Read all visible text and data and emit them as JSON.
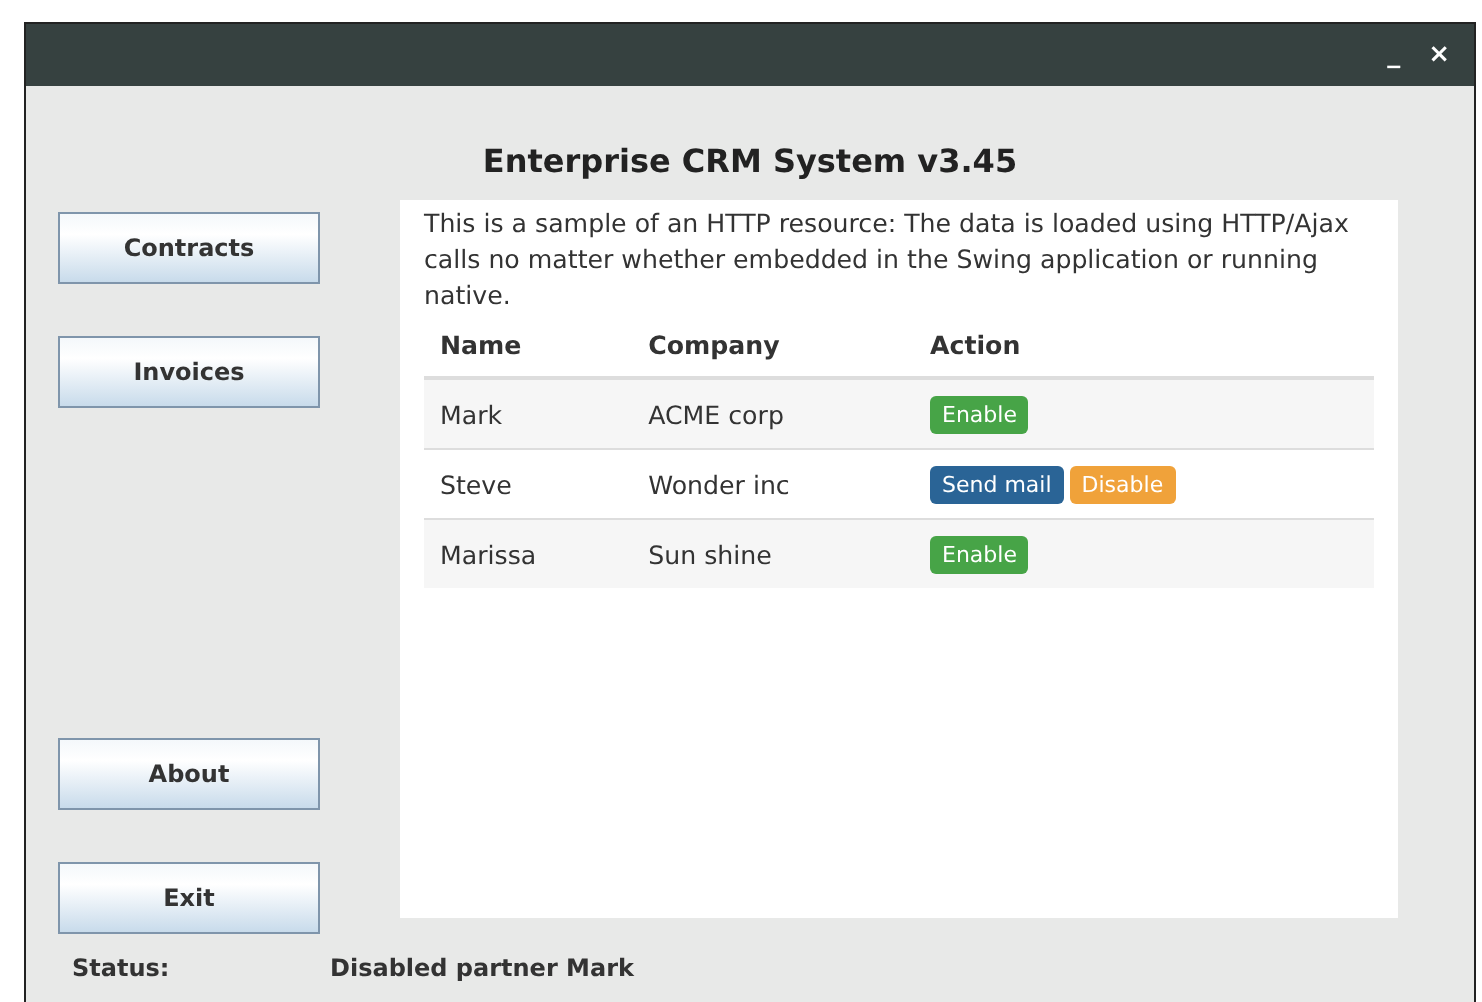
{
  "window": {
    "controls": [
      "_",
      "×"
    ]
  },
  "title": "Enterprise CRM System v3.45",
  "nav_top": [
    "Contracts",
    "Invoices"
  ],
  "nav_bottom": [
    "About",
    "Exit"
  ],
  "description": "This is a sample of an HTTP resource: The data is loaded using HTTP/Ajax calls no matter whether embedded in the Swing application or running native.",
  "table": {
    "columns": [
      "Name",
      "Company",
      "Action"
    ],
    "rows": [
      {
        "name": "Mark",
        "company": "ACME corp",
        "actions": [
          {
            "kind": "enable",
            "label": "Enable"
          }
        ]
      },
      {
        "name": "Steve",
        "company": "Wonder inc",
        "actions": [
          {
            "kind": "mail",
            "label": "Send mail"
          },
          {
            "kind": "disable",
            "label": "Disable"
          }
        ]
      },
      {
        "name": "Marissa",
        "company": "Sun shine",
        "actions": [
          {
            "kind": "enable",
            "label": "Enable"
          }
        ]
      }
    ]
  },
  "status_bar": {
    "label": "Status:",
    "message": "Disabled partner Mark"
  }
}
